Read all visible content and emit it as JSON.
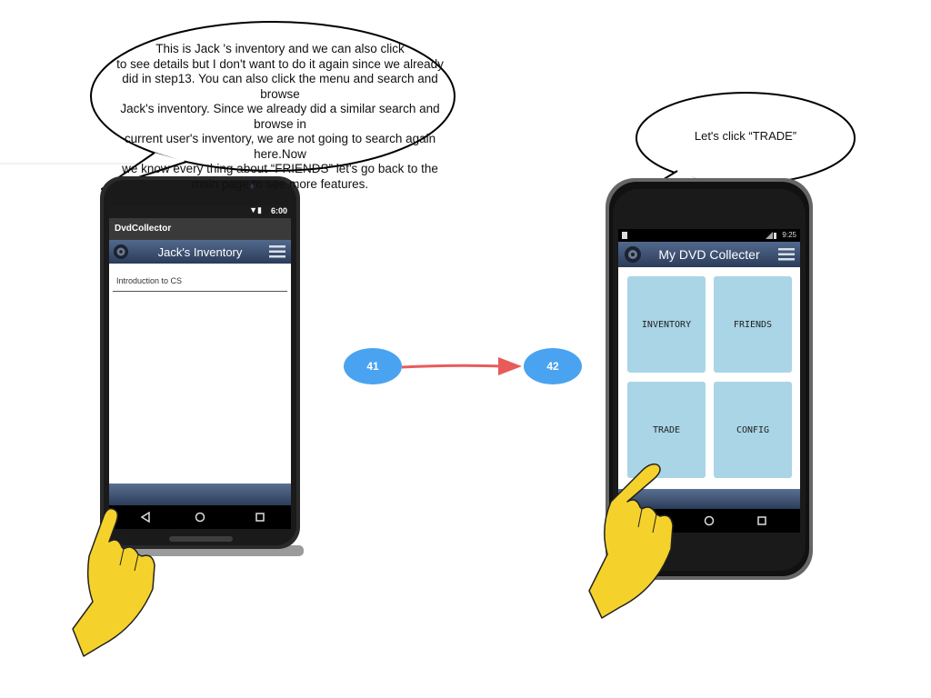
{
  "left_bubble": {
    "lines": [
      "This is Jack 's inventory and we can also click",
      "to see details but I don't want to do it again since we already",
      "did in step13. You can also click the menu and search and browse",
      "Jack's inventory. Since we already did a similar search and browse in",
      "current user's inventory, we are not going to search again here.Now",
      "we know every thing about “FRIENDS” let's go back to the",
      "main page to see more features."
    ]
  },
  "right_bubble": {
    "text": "Let's click “TRADE”"
  },
  "phone1": {
    "status_time": "6:00",
    "app_name": "DvdCollector",
    "toolbar_title": "Jack's Inventory",
    "items": [
      "Introduction to CS"
    ]
  },
  "phone2": {
    "status_time": "9:25",
    "toolbar_title": "My DVD Collecter",
    "tiles": {
      "inventory": "INVENTORY",
      "friends": "FRIENDS",
      "trade": "TRADE",
      "config": "CONFIG"
    }
  },
  "steps": {
    "from": "41",
    "to": "42"
  },
  "colors": {
    "toolbar_top": "#52698d",
    "toolbar_bottom": "#2b3c5a",
    "tile": "#a9d5e6",
    "badge": "#4aa3f0",
    "arrow": "#e85b5b",
    "hand": "#f4d22b"
  },
  "icons": {
    "menu": "hamburger-menu-icon",
    "logo": "dvd-disc-icon",
    "back": "back-nav-icon",
    "home": "home-nav-icon",
    "recents": "recents-nav-icon",
    "pointer": "pointing-hand-icon"
  }
}
